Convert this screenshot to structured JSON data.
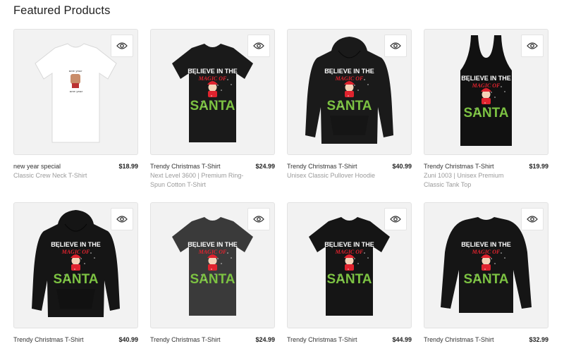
{
  "section": {
    "heading": "Featured Products"
  },
  "quick_view_icon": "eye-icon",
  "garment_text": {
    "line1": "BELIEVE IN THE",
    "line2": "MAGIC OF",
    "line3": "SANTA",
    "accent_green": "#7cc242",
    "accent_red": "#e0232e"
  },
  "products": [
    {
      "title": "new year special",
      "price": "$18.99",
      "subtitle": "Classic Crew Neck T-Shirt",
      "garment": "tshirt",
      "color": "#ffffff",
      "print": "small"
    },
    {
      "title": "Trendy Christmas T-Shirt",
      "price": "$24.99",
      "subtitle": "Next Level 3600 | Premium Ring-Spun Cotton T-Shirt",
      "garment": "tshirt",
      "color": "#1a1a1a",
      "print": "santa"
    },
    {
      "title": "Trendy Christmas T-Shirt",
      "price": "$40.99",
      "subtitle": "Unisex Classic Pullover Hoodie",
      "garment": "hoodie",
      "color": "#1a1a1a",
      "print": "santa"
    },
    {
      "title": "Trendy Christmas T-Shirt",
      "price": "$19.99",
      "subtitle": "Zuni 1003 | Unisex Premium Classic Tank Top",
      "garment": "tank",
      "color": "#111111",
      "print": "santa"
    },
    {
      "title": "Trendy Christmas T-Shirt",
      "price": "$40.99",
      "subtitle": "",
      "garment": "hoodie",
      "color": "#151515",
      "print": "santa"
    },
    {
      "title": "Trendy Christmas T-Shirt",
      "price": "$24.99",
      "subtitle": "",
      "garment": "tshirt",
      "color": "#3a3a3a",
      "print": "santa"
    },
    {
      "title": "Trendy Christmas T-Shirt",
      "price": "$44.99",
      "subtitle": "",
      "garment": "tshirt",
      "color": "#151515",
      "print": "santa"
    },
    {
      "title": "Trendy Christmas T-Shirt",
      "price": "$32.99",
      "subtitle": "",
      "garment": "sweatshirt",
      "color": "#151515",
      "print": "santa"
    }
  ]
}
